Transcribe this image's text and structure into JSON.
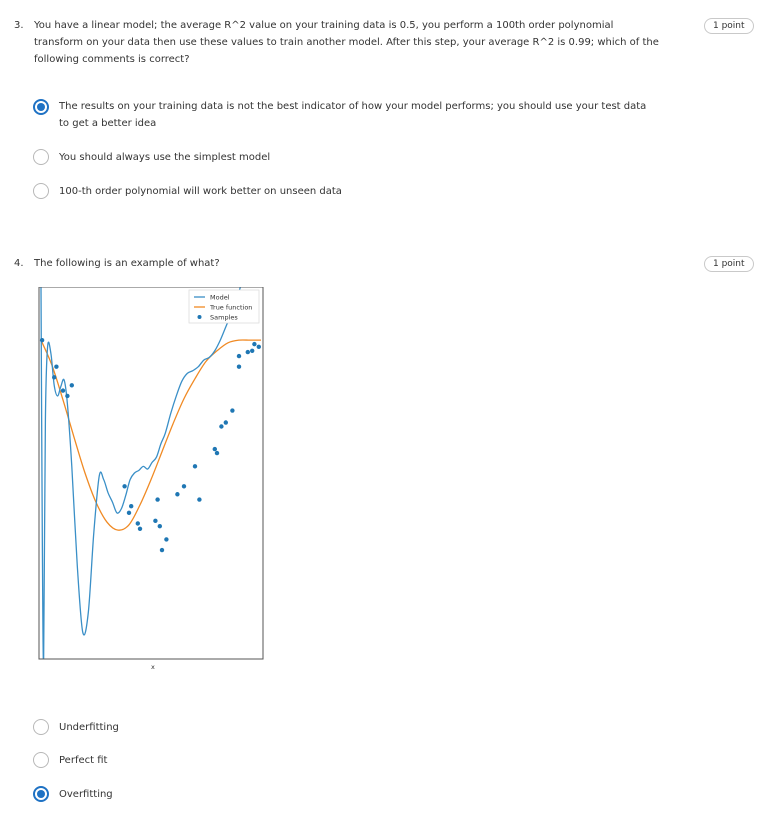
{
  "questions": [
    {
      "number": "3.",
      "text": "You have a linear model; the average R^2 value on your training data is 0.5, you perform a 100th order polynomial transform on your data then use these values to train another model. After this step, your average R^2 is 0.99; which of the following comments is correct?",
      "points": "1 point",
      "options": [
        {
          "label": "The results on your training data is not the best indicator of how your model performs; you should use your test data to get a better idea",
          "selected": true
        },
        {
          "label": "You should always use the simplest model",
          "selected": false
        },
        {
          "label": "100-th order polynomial will work better on unseen data",
          "selected": false
        }
      ]
    },
    {
      "number": "4.",
      "text": "The following is an example of what?",
      "points": "1 point",
      "options": [
        {
          "label": "Underfitting",
          "selected": false
        },
        {
          "label": "Perfect fit",
          "selected": false
        },
        {
          "label": "Overfitting",
          "selected": true
        }
      ]
    }
  ],
  "chart_data": {
    "type": "line",
    "xlabel": "x",
    "ylabel": "",
    "title": "",
    "xlim": [
      0,
      1
    ],
    "ylim": [
      -1.4,
      1.4
    ],
    "grid": false,
    "legend_position": "top-right",
    "legend": [
      "Model",
      "True function",
      "Samples"
    ],
    "colors": {
      "model": "#3a8fc7",
      "true_function": "#f08a24",
      "samples": "#1f77b4"
    },
    "series": [
      {
        "name": "Model",
        "type": "line",
        "x": [
          0.0,
          0.006,
          0.012,
          0.02,
          0.03,
          0.045,
          0.06,
          0.075,
          0.09,
          0.105,
          0.12,
          0.14,
          0.165,
          0.19,
          0.215,
          0.24,
          0.265,
          0.285,
          0.305,
          0.325,
          0.345,
          0.365,
          0.385,
          0.405,
          0.425,
          0.445,
          0.465,
          0.485,
          0.505,
          0.525,
          0.545,
          0.565,
          0.59,
          0.615,
          0.64,
          0.665,
          0.69,
          0.715,
          0.74,
          0.765,
          0.79,
          0.815,
          0.84,
          0.865,
          0.89,
          0.915,
          0.94,
          0.96,
          0.98,
          1.0
        ],
        "y": [
          1.4,
          -0.5,
          -1.4,
          0.4,
          0.95,
          0.9,
          0.66,
          0.58,
          0.65,
          0.7,
          0.52,
          0.05,
          -0.7,
          -1.2,
          -1.05,
          -0.45,
          -0.02,
          -0.05,
          -0.15,
          -0.22,
          -0.3,
          -0.27,
          -0.17,
          -0.05,
          0.0,
          0.02,
          0.05,
          0.03,
          0.08,
          0.12,
          0.22,
          0.3,
          0.45,
          0.58,
          0.69,
          0.75,
          0.77,
          0.8,
          0.85,
          0.87,
          0.92,
          1.0,
          1.1,
          1.2,
          1.3,
          1.45,
          1.52,
          1.5,
          1.5,
          1.7
        ]
      },
      {
        "name": "True function",
        "type": "line",
        "x": [
          0.0,
          0.05,
          0.1,
          0.15,
          0.2,
          0.25,
          0.3,
          0.35,
          0.4,
          0.45,
          0.5,
          0.55,
          0.6,
          0.65,
          0.7,
          0.75,
          0.8,
          0.85,
          0.9,
          0.95,
          1.0
        ],
        "y": [
          1.0,
          0.81,
          0.55,
          0.27,
          0.0,
          -0.22,
          -0.37,
          -0.43,
          -0.39,
          -0.24,
          -0.05,
          0.16,
          0.37,
          0.56,
          0.71,
          0.84,
          0.92,
          0.98,
          1.0,
          1.0,
          1.0
        ]
      },
      {
        "name": "Samples",
        "type": "scatter",
        "x": [
          0.005,
          0.06,
          0.07,
          0.1,
          0.12,
          0.14,
          0.38,
          0.4,
          0.41,
          0.44,
          0.45,
          0.52,
          0.53,
          0.54,
          0.55,
          0.57,
          0.62,
          0.65,
          0.7,
          0.72,
          0.79,
          0.8,
          0.82,
          0.84,
          0.87,
          0.9,
          0.9,
          0.94,
          0.96,
          0.97,
          0.99
        ],
        "y": [
          1.0,
          0.72,
          0.8,
          0.62,
          0.58,
          0.66,
          -0.1,
          -0.3,
          -0.25,
          -0.38,
          -0.42,
          -0.36,
          -0.2,
          -0.4,
          -0.58,
          -0.5,
          -0.16,
          -0.1,
          0.05,
          -0.2,
          0.18,
          0.15,
          0.35,
          0.38,
          0.47,
          0.8,
          0.88,
          0.91,
          0.92,
          0.97,
          0.95
        ]
      }
    ]
  }
}
